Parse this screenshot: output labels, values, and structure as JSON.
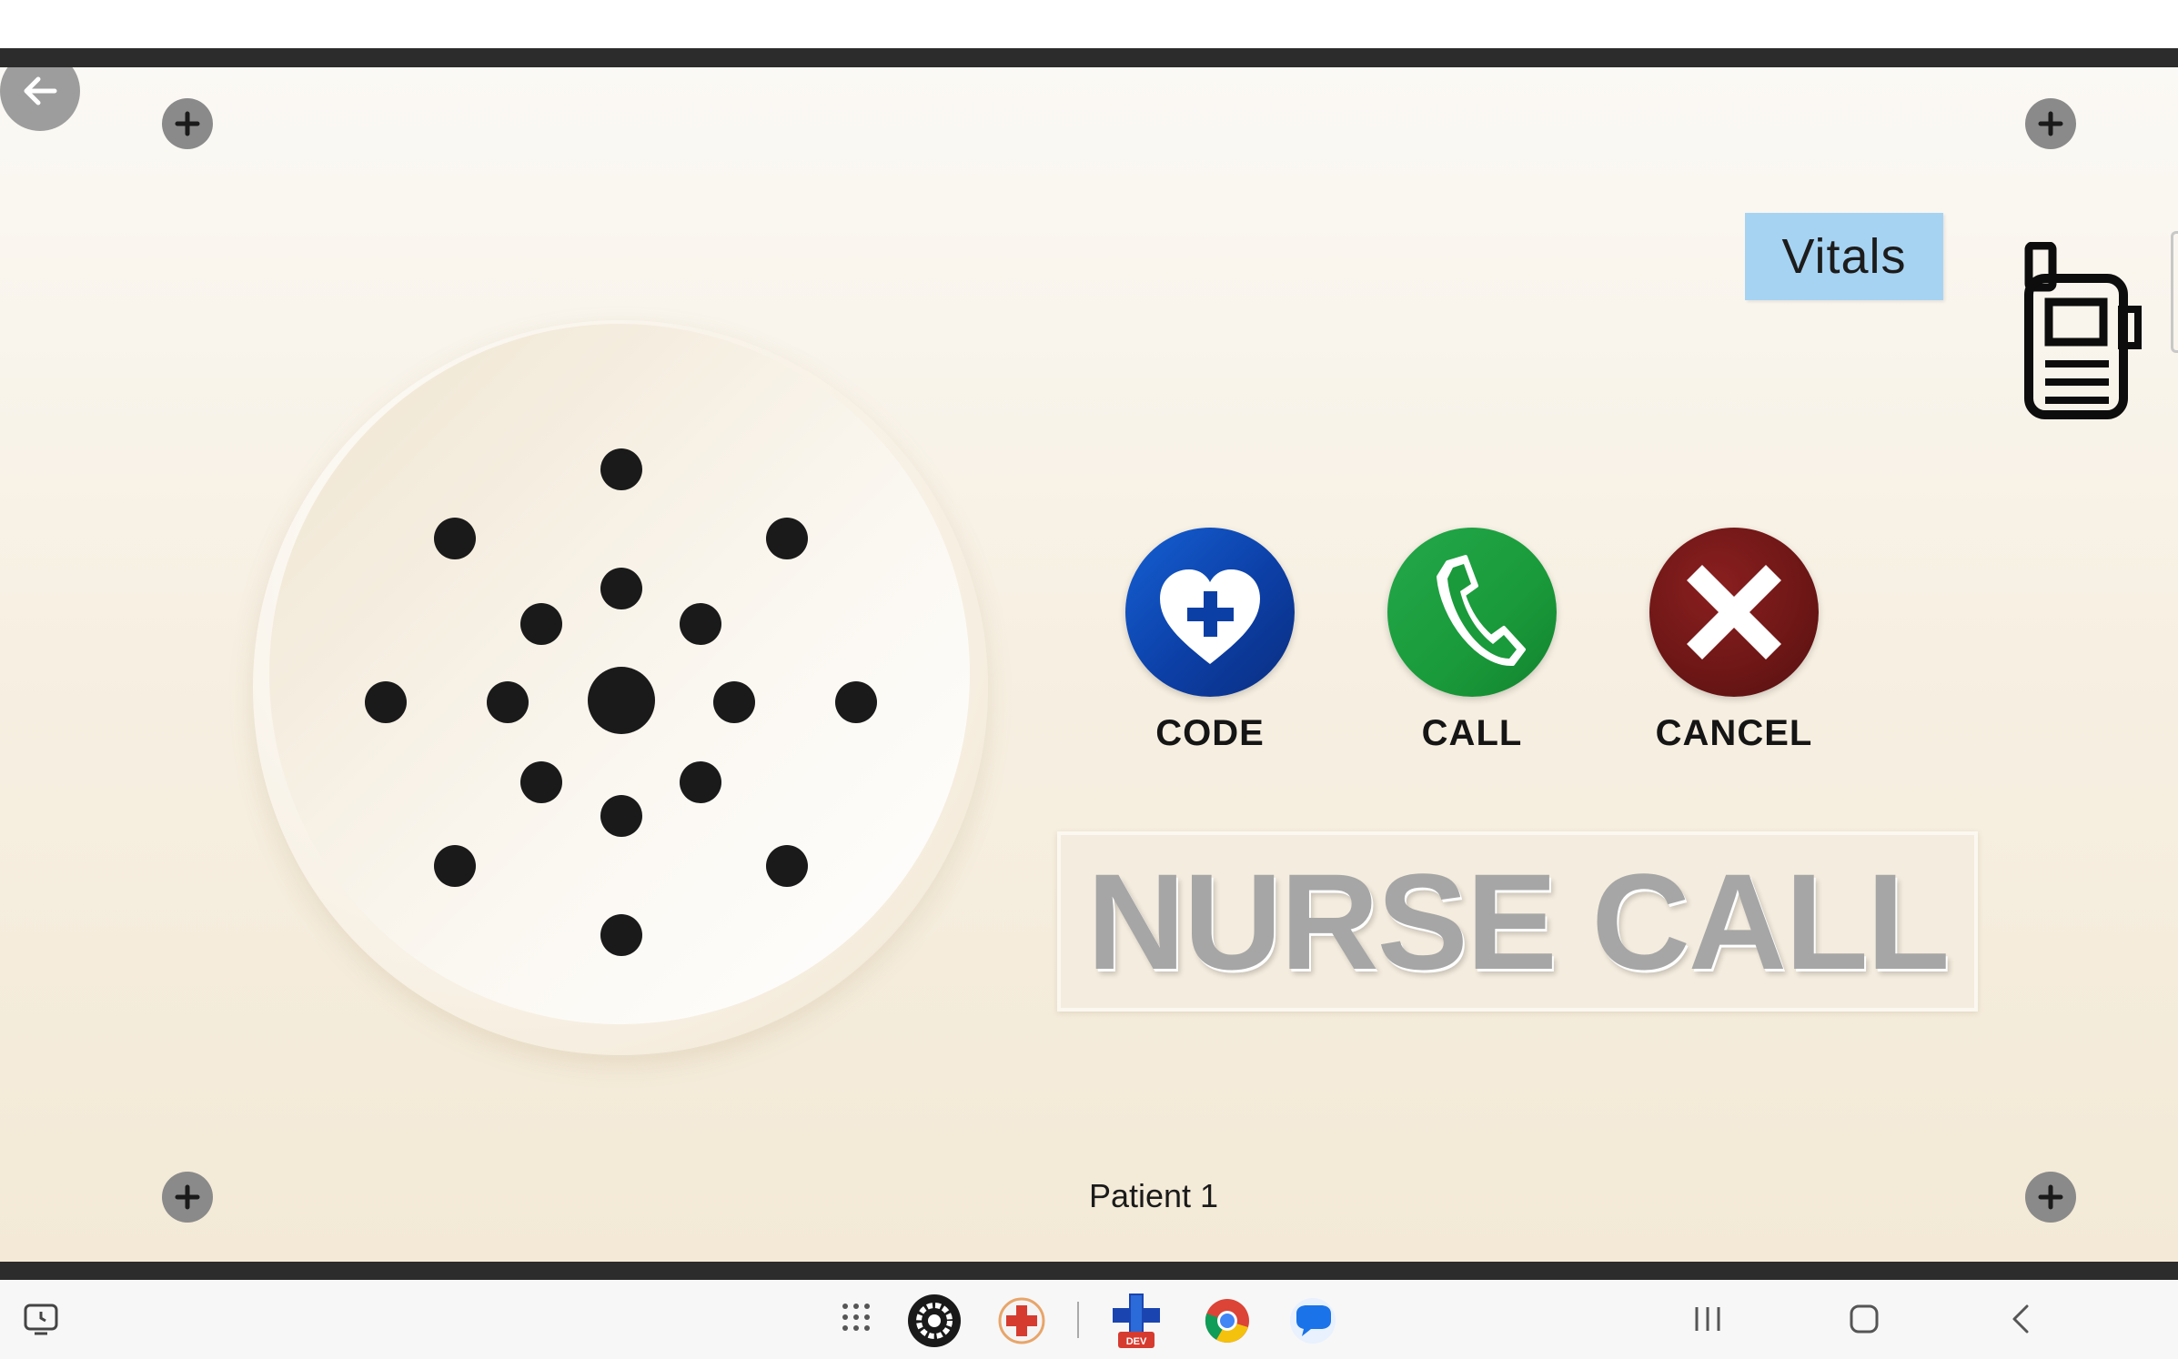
{
  "actions": {
    "code_label": "CODE",
    "call_label": "CALL",
    "cancel_label": "CANCEL"
  },
  "vitals_label": "Vitals",
  "banner_text": "NURSE CALL",
  "patient_label": "Patient 1",
  "dock_apps": [
    "settings-app",
    "medical-cross-app",
    "dev-medical-app",
    "chrome-app",
    "messages-app"
  ],
  "colors": {
    "vitals_bg": "#a7d3f2",
    "code_blue": "#0c3fa6",
    "call_green": "#1fa23b",
    "cancel_red": "#6d1616",
    "banner_text": "#a6a6a6"
  }
}
